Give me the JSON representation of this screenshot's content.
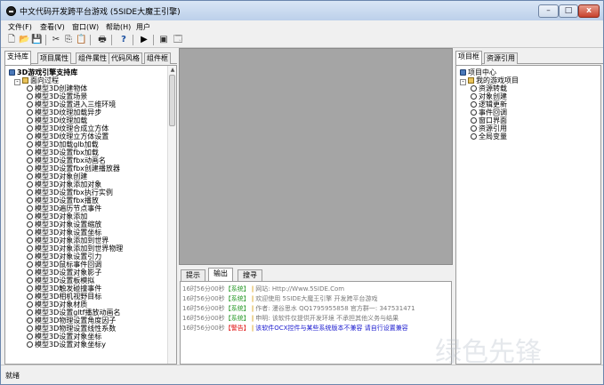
{
  "window": {
    "title": "中文代码开发跨平台游戏 (5SIDE大魔王引擎)",
    "min_label": "–",
    "max_label": "□",
    "close_label": "x"
  },
  "menu": [
    "文件(F)",
    "查看(V)",
    "窗口(W)",
    "帮助(H)",
    "用户"
  ],
  "toolbar": {
    "new": "🗋",
    "open": "📂",
    "save": "💾",
    "cut": "✂",
    "copy": "⎘",
    "paste": "📋",
    "print": "🖶",
    "help": "?",
    "run": "▶",
    "view": "▣",
    "window": "🗔"
  },
  "left_tabs": [
    "支持库",
    "项目属性",
    "组件属性",
    "代码风格",
    "组件框"
  ],
  "left_tree": {
    "root": "3D游戏引擎支持库",
    "folder": "面向过程",
    "items": [
      "模型3D创建物体",
      "模型3D设置场景",
      "模型3D设置进入三维环境",
      "模型3D纹理加载异步",
      "模型3D纹理加载",
      "模型3D纹理合成立方体",
      "模型3D纹理立方体设置",
      "模型3D加载glb加载",
      "模型3D设置fbx加载",
      "模型3D设置fbx动画名",
      "模型3D设置fbx创建播放器",
      "模型3D对象创建",
      "模型3D对象添加对象",
      "模型3D设置fbx执行实例",
      "模型3D设置fbx播放",
      "模型3D遍历节点事件",
      "模型3D对象添加",
      "模型3D对象设置缩放",
      "模型3D对象设置坐标",
      "模型3D对象添加到世界",
      "模型3D对象添加到世界物理",
      "模型3D对象设置引力",
      "模型3D鼠标事件回调",
      "模型3D设置对象影子",
      "模型3D设置板模拟",
      "模型3D触发碰撞事件",
      "模型3D相机视野目标",
      "模型3D对象材质",
      "模型3D设置gltf播放动画名",
      "模型3D物理设置角度因子",
      "模型3D物理设置线性系数",
      "模型3D设置对象坐标",
      "模型3D设置对象坐标y"
    ]
  },
  "bottom_tabs": [
    "提示",
    "输出",
    "搜寻"
  ],
  "output_lines": [
    {
      "time": "16时56分00秒",
      "tag": "【系统】",
      "msg": "网站: Http://Www.5SIDE.Com",
      "level": "info"
    },
    {
      "time": "16时56分00秒",
      "tag": "【系统】",
      "msg": "欢迎使用 5SIDE大魔王引擎 开发跨平台游戏",
      "level": "info"
    },
    {
      "time": "16时56分00秒",
      "tag": "【系统】",
      "msg": "作者: 漫谷思水 QQ1795955858  官方群一: 347531471",
      "level": "info"
    },
    {
      "time": "16时56分00秒",
      "tag": "【系统】",
      "msg": "申明: 该软件仅提供开发环境 不承担其他义务与结果",
      "level": "info"
    },
    {
      "time": "16时56分00秒",
      "tag": "【警告】",
      "msg": "该软件OCX控件与某些系统版本不兼容 请自行设置兼容",
      "level": "warn"
    }
  ],
  "right_tabs": [
    "项目框",
    "资源引用"
  ],
  "right_tree": {
    "root": "项目中心",
    "folder": "我的游戏项目",
    "items": [
      "资源转载",
      "对象创建",
      "逻辑更新",
      "事件回调",
      "窗口界面",
      "资源引用",
      "全局变量"
    ]
  },
  "status": "就绪",
  "watermark": "绿色先锋"
}
